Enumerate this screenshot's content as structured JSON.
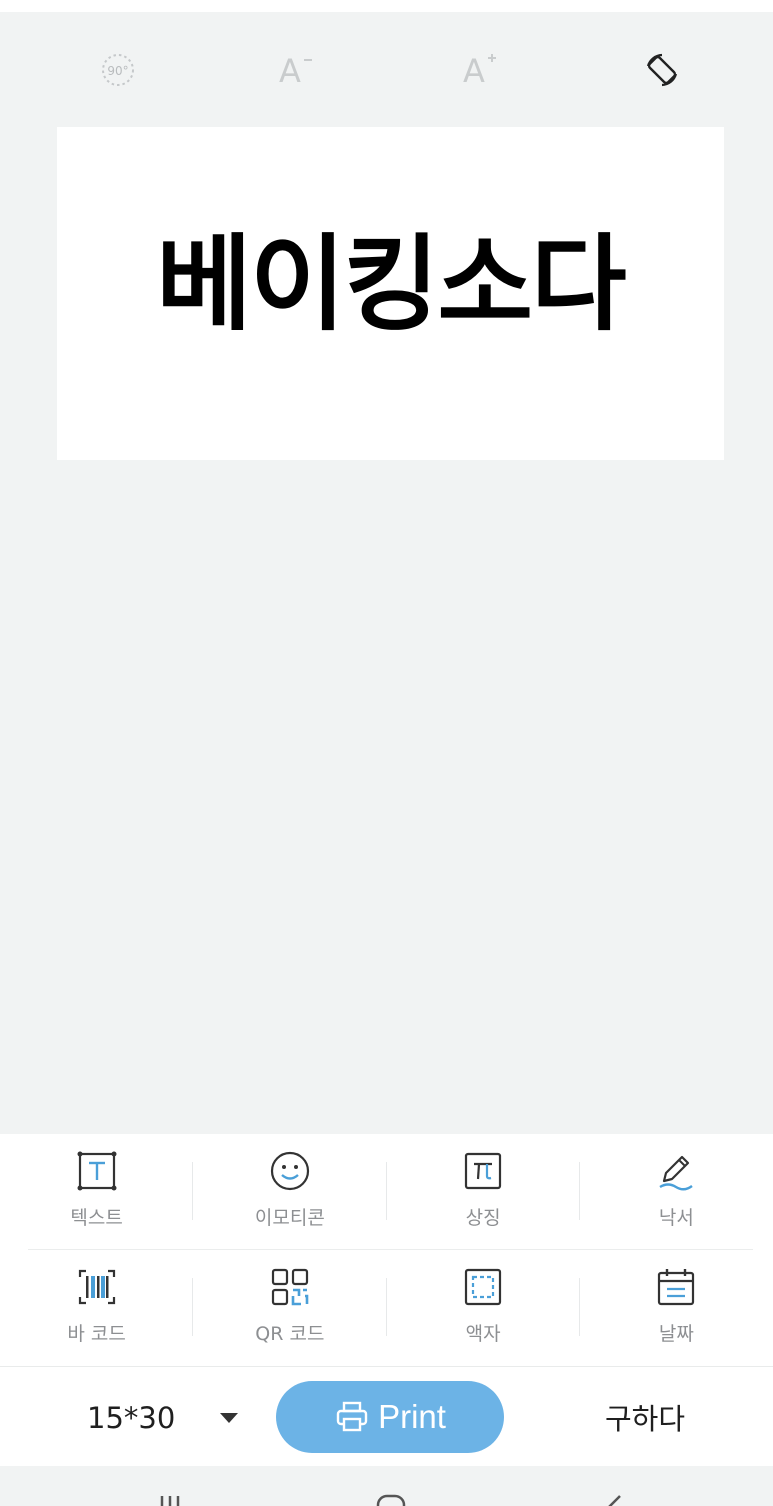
{
  "canvas": {
    "text": "베이킹소다"
  },
  "toolbar": {
    "rotate_icon_label": "90°",
    "font_decrease_label": "A",
    "font_increase_label": "A"
  },
  "tools": {
    "row1": [
      {
        "label": "텍스트",
        "icon": "text-box-icon"
      },
      {
        "label": "이모티콘",
        "icon": "smiley-icon"
      },
      {
        "label": "상징",
        "icon": "pi-symbol-icon"
      },
      {
        "label": "낙서",
        "icon": "pencil-icon"
      }
    ],
    "row2": [
      {
        "label": "바 코드",
        "icon": "barcode-icon"
      },
      {
        "label": "QR 코드",
        "icon": "qr-code-icon"
      },
      {
        "label": "액자",
        "icon": "frame-icon"
      },
      {
        "label": "날짜",
        "icon": "calendar-icon"
      }
    ]
  },
  "action_bar": {
    "label_size": "15*30",
    "print_label": "Print",
    "buy_label": "구하다"
  },
  "colors": {
    "accent": "#6cb3e6",
    "background": "#f1f3f3",
    "label_gray": "#8d8f92",
    "icon_dark": "#333333"
  }
}
